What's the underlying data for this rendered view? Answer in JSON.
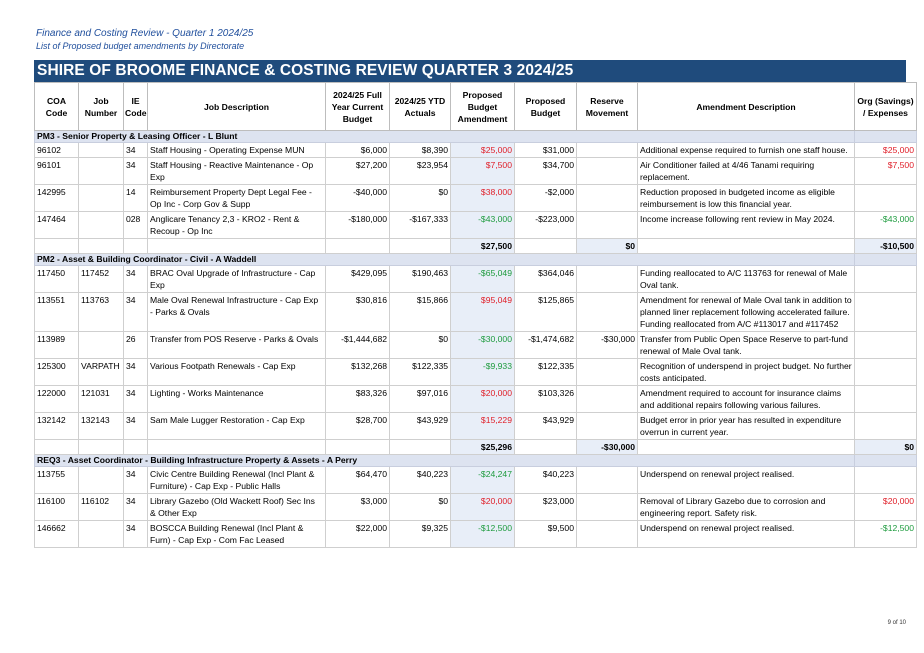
{
  "header": {
    "title": "Finance and Costing Review - Quarter 1 2024/25",
    "subtitle": "List of Proposed budget amendments by Directorate",
    "banner": "SHIRE OF BROOME FINANCE & COSTING REVIEW QUARTER 3  2024/25"
  },
  "columns": {
    "coa": "COA Code",
    "job": "Job Number",
    "ie": "IE Code",
    "desc": "Job Description",
    "budget": "2024/25 Full Year Current Budget",
    "ytd": "2024/25 YTD Actuals",
    "amend": "Proposed Budget Amendment",
    "proposed": "Proposed Budget",
    "reserve": "Reserve Movement",
    "amend_desc": "Amendment Description",
    "org": "Org (Savings) / Expenses"
  },
  "sections": [
    {
      "title": "PM3 - Senior Property & Leasing Officer - L Blunt",
      "rows": [
        {
          "coa": "96102",
          "job": "",
          "ie": "34",
          "desc": "Staff Housing - Operating Expense MUN",
          "budget": "$6,000",
          "ytd": "$8,390",
          "amend": "$25,000",
          "proposed": "$31,000",
          "reserve": "",
          "amend_desc": "Additional expense required to furnish one staff house.",
          "org": "$25,000"
        },
        {
          "coa": "96101",
          "job": "",
          "ie": "34",
          "desc": "Staff Housing - Reactive Maintenance - Op Exp",
          "budget": "$27,200",
          "ytd": "$23,954",
          "amend": "$7,500",
          "proposed": "$34,700",
          "reserve": "",
          "amend_desc": "Air Conditioner failed at 4/46 Tanami requiring replacement.",
          "org": "$7,500"
        },
        {
          "coa": "142995",
          "job": "",
          "ie": "14",
          "desc": "Reimbursement Property Dept Legal Fee - Op Inc - Corp Gov & Supp",
          "budget": "-$40,000",
          "ytd": "$0",
          "amend": "$38,000",
          "proposed": "-$2,000",
          "reserve": "",
          "amend_desc": "Reduction proposed in budgeted income as eligible reimbursement is low this financial year.",
          "org": ""
        },
        {
          "coa": "147464",
          "job": "",
          "ie": "028",
          "desc": "Anglicare Tenancy 2,3 - KRO2 - Rent & Recoup - Op Inc",
          "budget": "-$180,000",
          "ytd": "-$167,333",
          "amend": "-$43,000",
          "proposed": "-$223,000",
          "reserve": "",
          "amend_desc": "Income increase following rent review in May 2024.",
          "org": "-$43,000"
        }
      ],
      "totals": {
        "amend": "$27,500",
        "reserve": "$0",
        "org": "-$10,500"
      }
    },
    {
      "title": "PM2 - Asset & Building Coordinator - Civil - A Waddell",
      "rows": [
        {
          "coa": "117450",
          "job": "117452",
          "ie": "34",
          "desc": "BRAC Oval Upgrade of Infrastructure - Cap Exp",
          "budget": "$429,095",
          "ytd": "$190,463",
          "amend": "-$65,049",
          "proposed": "$364,046",
          "reserve": "",
          "amend_desc": "Funding reallocated to A/C 113763 for renewal of Male Oval tank.",
          "org": ""
        },
        {
          "coa": "113551",
          "job": "113763",
          "ie": "34",
          "desc": "Male Oval Renewal Infrastructure - Cap Exp - Parks & Ovals",
          "budget": "$30,816",
          "ytd": "$15,866",
          "amend": "$95,049",
          "proposed": "$125,865",
          "reserve": "",
          "amend_desc": "Amendment for renewal of Male Oval tank in addition to planned liner replacement following accelerated failure. Funding reallocated from A/C #113017 and #117452",
          "org": ""
        },
        {
          "coa": "113989",
          "job": "",
          "ie": "26",
          "desc": "Transfer from POS Reserve - Parks & Ovals",
          "budget": "-$1,444,682",
          "ytd": "$0",
          "amend": "-$30,000",
          "proposed": "-$1,474,682",
          "reserve": "-$30,000",
          "amend_desc": "Transfer from Public Open Space Reserve to part-fund renewal of Male Oval tank.",
          "org": ""
        },
        {
          "coa": "125300",
          "job": "VARPATH",
          "ie": "34",
          "desc": "Various Footpath Renewals - Cap Exp",
          "budget": "$132,268",
          "ytd": "$122,335",
          "amend": "-$9,933",
          "proposed": "$122,335",
          "reserve": "",
          "amend_desc": "Recognition of underspend in project budget. No further costs anticipated.",
          "org": ""
        },
        {
          "coa": "122000",
          "job": "121031",
          "ie": "34",
          "desc": "Lighting - Works Maintenance",
          "budget": "$83,326",
          "ytd": "$97,016",
          "amend": "$20,000",
          "proposed": "$103,326",
          "reserve": "",
          "amend_desc": "Amendment required to account for insurance claims and additional repairs following various failures.",
          "org": ""
        },
        {
          "coa": "132142",
          "job": "132143",
          "ie": "34",
          "desc": "Sam Male Lugger Restoration - Cap Exp",
          "budget": "$28,700",
          "ytd": "$43,929",
          "amend": "$15,229",
          "proposed": "$43,929",
          "reserve": "",
          "amend_desc": "Budget error in prior year has resulted in expenditure overrun in current year.",
          "org": ""
        }
      ],
      "totals": {
        "amend": "$25,296",
        "reserve": "-$30,000",
        "org": "$0"
      }
    },
    {
      "title": "REQ3 - Asset Coordinator - Building Infrastructure Property & Assets - A Perry",
      "rows": [
        {
          "coa": "113755",
          "job": "",
          "ie": "34",
          "desc": "Civic Centre Building Renewal (Incl Plant & Furniture) - Cap Exp - Public Halls",
          "budget": "$64,470",
          "ytd": "$40,223",
          "amend": "-$24,247",
          "proposed": "$40,223",
          "reserve": "",
          "amend_desc": "Underspend on renewal project realised.",
          "org": ""
        },
        {
          "coa": "116100",
          "job": "116102",
          "ie": "34",
          "desc": "Library Gazebo (Old Wackett Roof) Sec Ins & Other Exp",
          "budget": "$3,000",
          "ytd": "$0",
          "amend": "$20,000",
          "proposed": "$23,000",
          "reserve": "",
          "amend_desc": "Removal of Library Gazebo due to corrosion and engineering report. Safety risk.",
          "org": "$20,000"
        },
        {
          "coa": "146662",
          "job": "",
          "ie": "34",
          "desc": "BOSCCA Building Renewal (Incl Plant & Furn) - Cap Exp - Com Fac Leased",
          "budget": "$22,000",
          "ytd": "$9,325",
          "amend": "-$12,500",
          "proposed": "$9,500",
          "reserve": "",
          "amend_desc": "Underspend on renewal project realised.",
          "org": "-$12,500"
        }
      ]
    }
  ],
  "footer": {
    "page": "9 of 10"
  },
  "colors": {
    "banner": "#1f4b7c",
    "section": "#dde3f0",
    "negative_red": "#e0202a",
    "positive_green": "#1e9b3e"
  }
}
